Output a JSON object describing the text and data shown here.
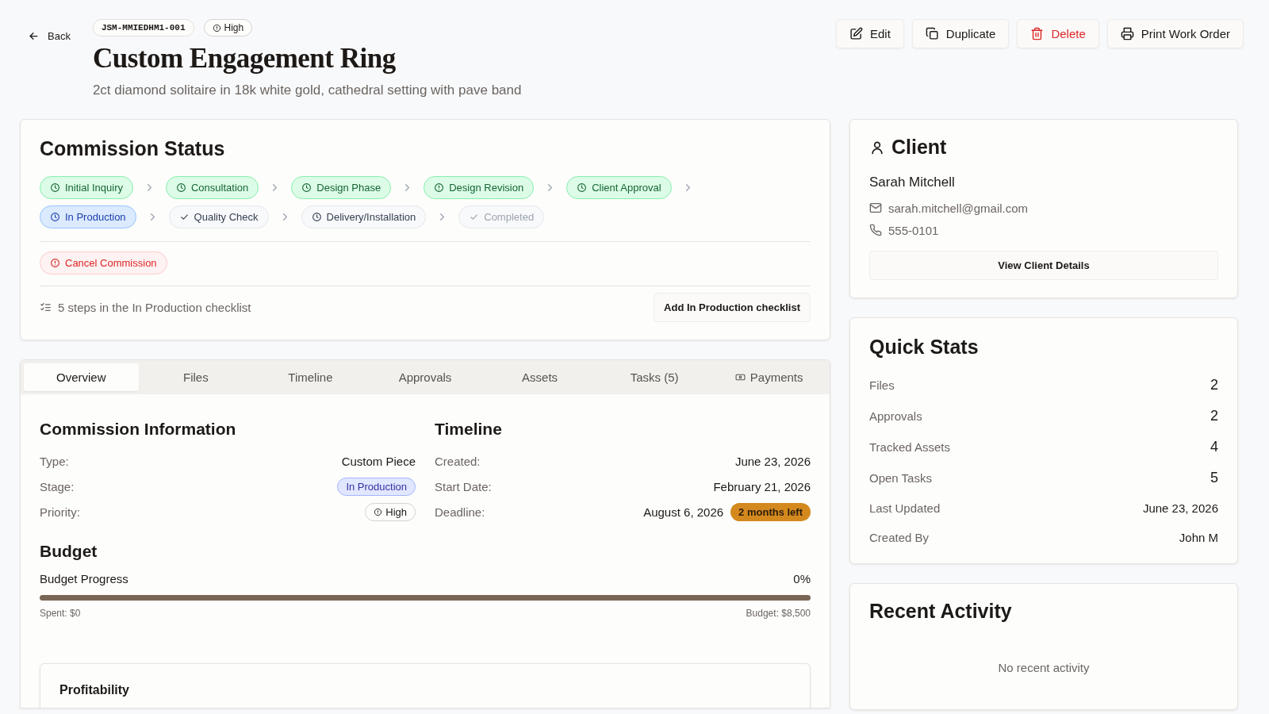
{
  "header": {
    "back": "Back",
    "code": "JSM-MMIEDHM1-001",
    "priority": "High",
    "title": "Custom Engagement Ring",
    "subtitle": "2ct diamond solitaire in 18k white gold, cathedral setting with pave band",
    "actions": [
      {
        "label": "Edit",
        "kind": "edit"
      },
      {
        "label": "Duplicate",
        "kind": "duplicate"
      },
      {
        "label": "Delete",
        "kind": "delete"
      },
      {
        "label": "Print Work Order",
        "kind": "print"
      }
    ]
  },
  "commission_status": {
    "title": "Commission Status",
    "stages": [
      {
        "label": "Initial Inquiry",
        "completed": true,
        "selected": false,
        "disabled": false,
        "kind": "scheduled"
      },
      {
        "label": "Consultation",
        "completed": true,
        "selected": false,
        "disabled": false,
        "kind": "scheduled"
      },
      {
        "label": "Design Phase",
        "completed": true,
        "selected": false,
        "disabled": false,
        "kind": "scheduled"
      },
      {
        "label": "Design Revision",
        "completed": true,
        "selected": false,
        "disabled": false,
        "kind": "flagged"
      },
      {
        "label": "Client Approval",
        "completed": true,
        "selected": false,
        "disabled": false,
        "kind": "scheduled"
      },
      {
        "label": "In Production",
        "completed": false,
        "selected": true,
        "disabled": false,
        "kind": "scheduled"
      },
      {
        "label": "Quality Check",
        "completed": false,
        "selected": false,
        "disabled": false,
        "kind": "checked"
      },
      {
        "label": "Delivery/Installation",
        "completed": false,
        "selected": false,
        "disabled": false,
        "kind": "scheduled"
      },
      {
        "label": "Completed",
        "completed": false,
        "selected": false,
        "disabled": true,
        "kind": "checked"
      }
    ],
    "cancel": "Cancel Commission",
    "checklist_text": "5 steps in the In Production checklist",
    "checklist_button": "Add In Production checklist"
  },
  "tabs": [
    {
      "label": "Overview",
      "selected": true
    },
    {
      "label": "Files",
      "selected": false
    },
    {
      "label": "Timeline",
      "selected": false
    },
    {
      "label": "Approvals",
      "selected": false
    },
    {
      "label": "Assets",
      "selected": false
    },
    {
      "label": "Tasks (5)",
      "selected": false
    },
    {
      "label": "Payments",
      "selected": false,
      "kind": "payment"
    }
  ],
  "overview": {
    "info": {
      "title": "Commission Information",
      "rows": [
        {
          "label": "Type:",
          "value": "Custom Piece",
          "kind": "text"
        },
        {
          "label": "Stage:",
          "value": "In Production",
          "kind": "stage"
        },
        {
          "label": "Priority:",
          "value": "High",
          "kind": "priority"
        }
      ]
    },
    "timeline": {
      "title": "Timeline",
      "rows": [
        {
          "label": "Created:",
          "value": "June 23, 2026"
        },
        {
          "label": "Start Date:",
          "value": "February 21, 2026"
        },
        {
          "label": "Deadline:",
          "value": "August 6, 2026",
          "badge": "2 months left"
        }
      ]
    },
    "budget": {
      "title": "Budget",
      "label": "Budget Progress",
      "percent": "0%",
      "level": 0,
      "spent": "Spent: $0",
      "total": "Budget: $8,500"
    },
    "profitability": {
      "title": "Profitability"
    }
  },
  "client": {
    "title": "Client",
    "name": "Sarah Mitchell",
    "email": "sarah.mitchell@gmail.com",
    "phone": "555-0101",
    "button": "View Client Details"
  },
  "quick_stats": {
    "title": "Quick Stats",
    "rows": [
      {
        "label": "Files",
        "value": "2",
        "kind": "count"
      },
      {
        "label": "Approvals",
        "value": "2",
        "kind": "count"
      },
      {
        "label": "Tracked Assets",
        "value": "4",
        "kind": "count"
      },
      {
        "label": "Open Tasks",
        "value": "5",
        "kind": "count"
      },
      {
        "label": "Last Updated",
        "value": "June 23, 2026",
        "kind": "text"
      },
      {
        "label": "Created By",
        "value": "John M",
        "kind": "text"
      }
    ]
  },
  "recent_activity": {
    "title": "Recent Activity",
    "empty": "No recent activity"
  }
}
